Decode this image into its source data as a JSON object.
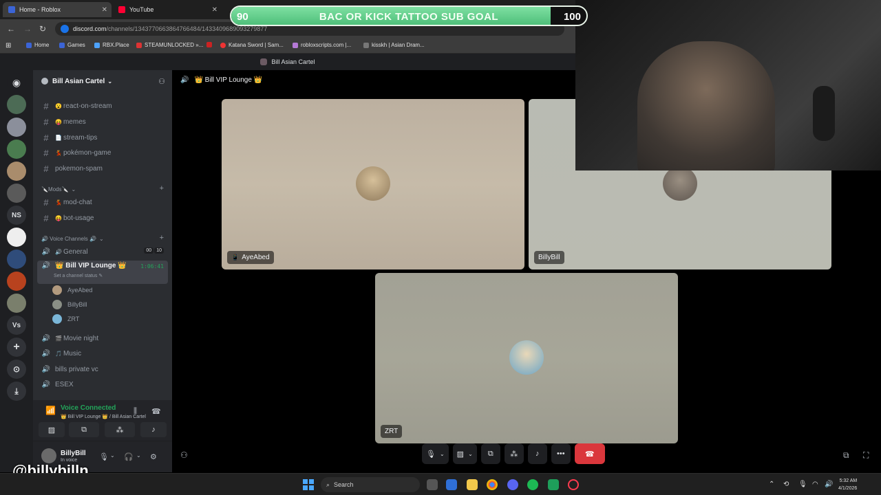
{
  "browser": {
    "tabs": [
      {
        "title": "Home - Roblox"
      },
      {
        "title": "YouTube"
      }
    ],
    "url_host": "discord.com",
    "url_path": "/channels/1343770663864766484/1433409689093279877",
    "bookmarks": [
      {
        "label": "Home"
      },
      {
        "label": "Games"
      },
      {
        "label": "RBX.Place"
      },
      {
        "label": "STEAMUNLOCKED »..."
      },
      {
        "label": "Katana Sword | Sam..."
      },
      {
        "label": "robloxscripts.com |..."
      },
      {
        "label": "kisskh | Asian Dram..."
      }
    ]
  },
  "discord": {
    "window_title": "Bill Asian Cartel",
    "server_name": "Bill Asian Cartel",
    "text_channels": [
      {
        "name": "react-on-stream",
        "emoji": "😮"
      },
      {
        "name": "memes",
        "emoji": "😝"
      },
      {
        "name": "stream-tips",
        "emoji": "📄"
      },
      {
        "name": "pokémon-game",
        "emoji": "💃"
      },
      {
        "name": "pokemon-spam",
        "emoji": ""
      }
    ],
    "mods_category": "🔪Mods🔪",
    "mod_channels": [
      {
        "name": "mod-chat",
        "emoji": "💃"
      },
      {
        "name": "bot-usage",
        "emoji": "😝"
      }
    ],
    "voice_category": "🔊 Voice Channels 🔊",
    "voice_general": {
      "name": "General",
      "emoji": "🔊",
      "count_now": "00",
      "count_limit": "10"
    },
    "voice_active": {
      "name": "👑 Bill VIP Lounge 👑",
      "timer": "1:06:41",
      "status_hint": "Set a channel status ✎"
    },
    "voice_members": [
      "AyeAbed",
      "BillyBill",
      "ZRT"
    ],
    "voice_channels_more": [
      {
        "name": "Movie night",
        "emoji": "🎬"
      },
      {
        "name": "Music",
        "emoji": "🎵"
      },
      {
        "name": "bills private vc",
        "emoji": ""
      },
      {
        "name": "ESEX",
        "emoji": ""
      }
    ],
    "voice_connected": {
      "title": "Voice Connected",
      "subtitle": "👑 Bill VIP Lounge 👑 / Bill Asian Cartel"
    },
    "user": {
      "name": "BillyBill",
      "status": "In voice"
    },
    "stage_title": "👑 Bill VIP Lounge 👑",
    "tiles": [
      {
        "name": "AyeAbed",
        "mobile_icon": "📱"
      },
      {
        "name": "BillyBill"
      },
      {
        "name": "ZRT"
      }
    ]
  },
  "overlay": {
    "goal_text": "BAC OR KICK TATTOO SUB GOAL",
    "goal_current": "90",
    "goal_target": "100",
    "goal_progress": 0.9,
    "handle": "@billybilln"
  },
  "taskbar": {
    "search_placeholder": "Search",
    "time": "5:32 AM",
    "date": "4/1/2026"
  },
  "colors": {
    "discord_green": "#23a55a",
    "hangup_red": "#da373c",
    "goal_green": "#7ee0a2"
  }
}
